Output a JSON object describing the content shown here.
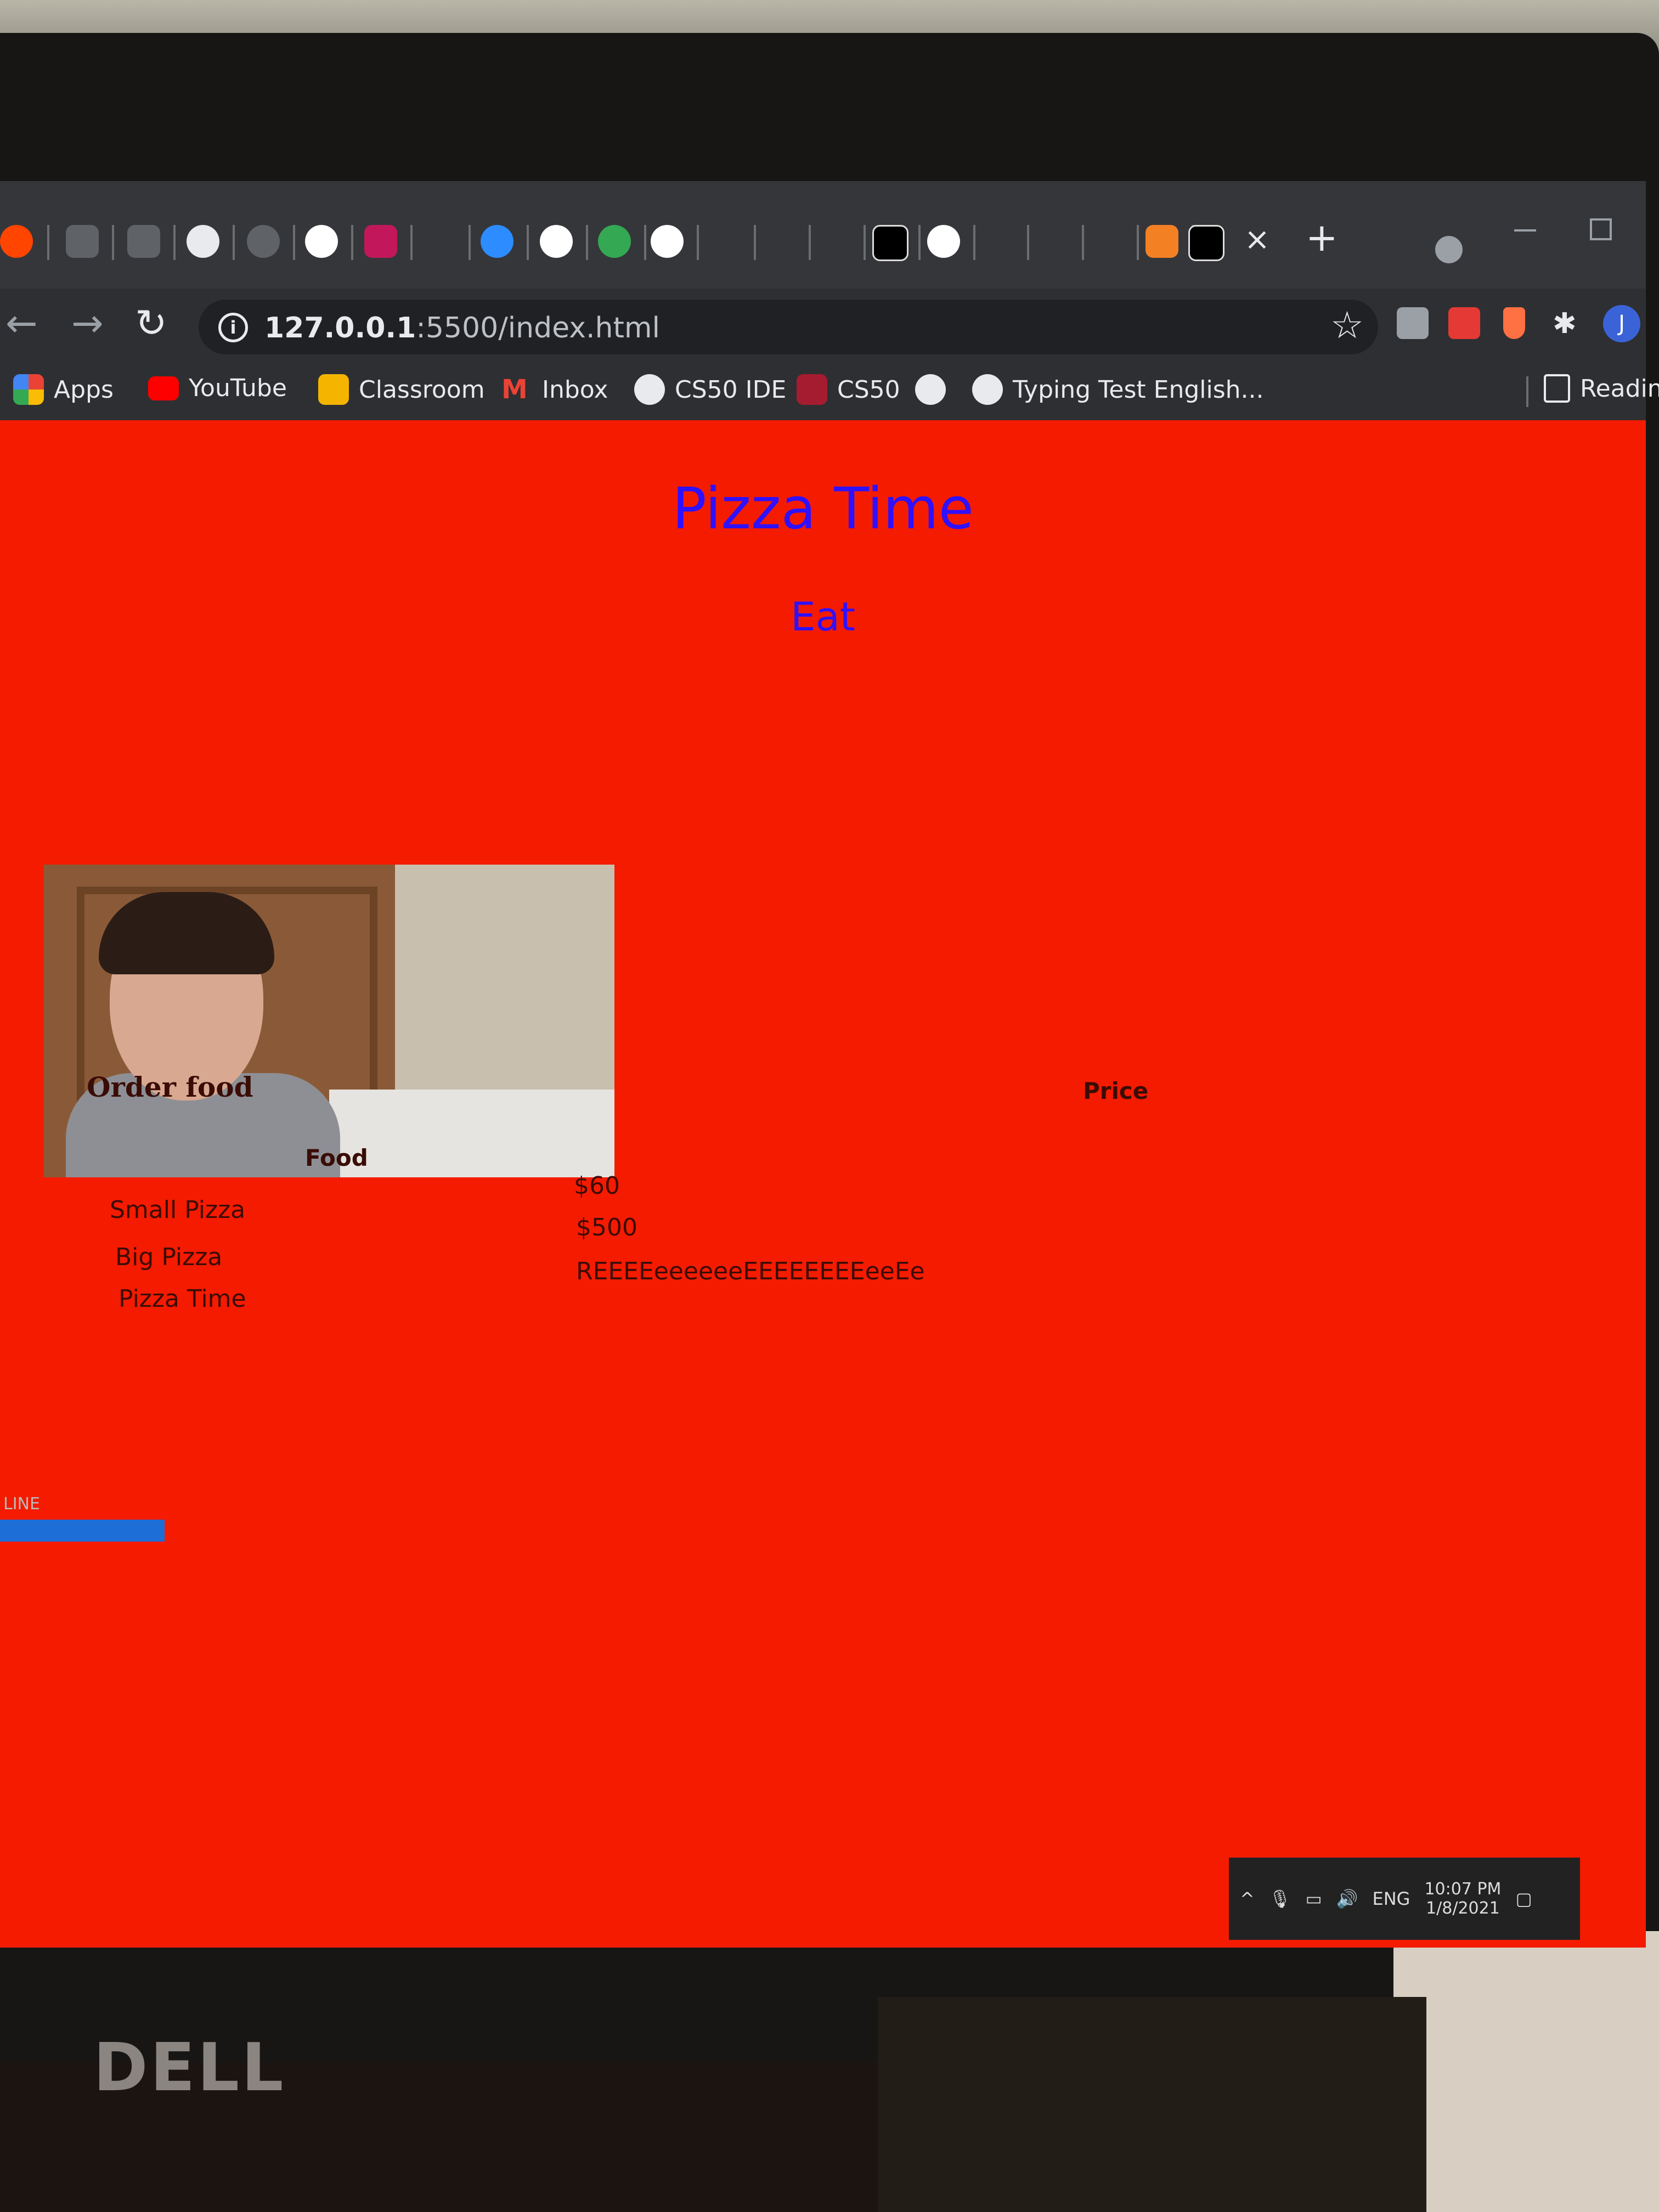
{
  "browser": {
    "url_host": "127.0.0.1",
    "url_rest": ":5500/index.html",
    "tab_close": "×",
    "new_tab": "+",
    "avatar_initial": "J"
  },
  "bookmarks": [
    {
      "label": "Apps",
      "icon": "apps-grid-icon",
      "color": "#ea4335"
    },
    {
      "label": "YouTube",
      "icon": "youtube-icon",
      "color": "#ff0000"
    },
    {
      "label": "Classroom",
      "icon": "classroom-icon",
      "color": "#f4b400"
    },
    {
      "label": "Inbox",
      "icon": "gmail-icon",
      "color": "#ea4335"
    },
    {
      "label": "CS50 IDE",
      "icon": "globe-icon",
      "color": "#e8eaed"
    },
    {
      "label": "CS50",
      "icon": "harvard-icon",
      "color": "#a51c30"
    },
    {
      "label": "",
      "icon": "globe-icon",
      "color": "#e8eaed"
    },
    {
      "label": "Typing Test English...",
      "icon": "globe-icon",
      "color": "#e8eaed"
    },
    {
      "label": "Reading l",
      "icon": "reading-list-icon",
      "color": "#e8eaed"
    }
  ],
  "page": {
    "title": "Pizza Time",
    "subtitle": "Eat",
    "order_label": "Order food",
    "table": {
      "headers": {
        "food": "Food",
        "price": "Price"
      },
      "rows": [
        {
          "food": "Small Pizza",
          "price": "$60"
        },
        {
          "food": "Big Pizza",
          "price": "$500"
        },
        {
          "food": "Pizza Time",
          "price": "REEEEeeeeeeEEEEEEEEeeEe"
        }
      ]
    },
    "background_color": "#f41b00",
    "heading_color": "#2f10ff"
  },
  "taskbar": {
    "language": "ENG",
    "time": "10:07 PM",
    "date": "1/8/2021"
  },
  "monitor": {
    "brand": "DELL"
  },
  "editor": {
    "status_text": "LINE"
  }
}
